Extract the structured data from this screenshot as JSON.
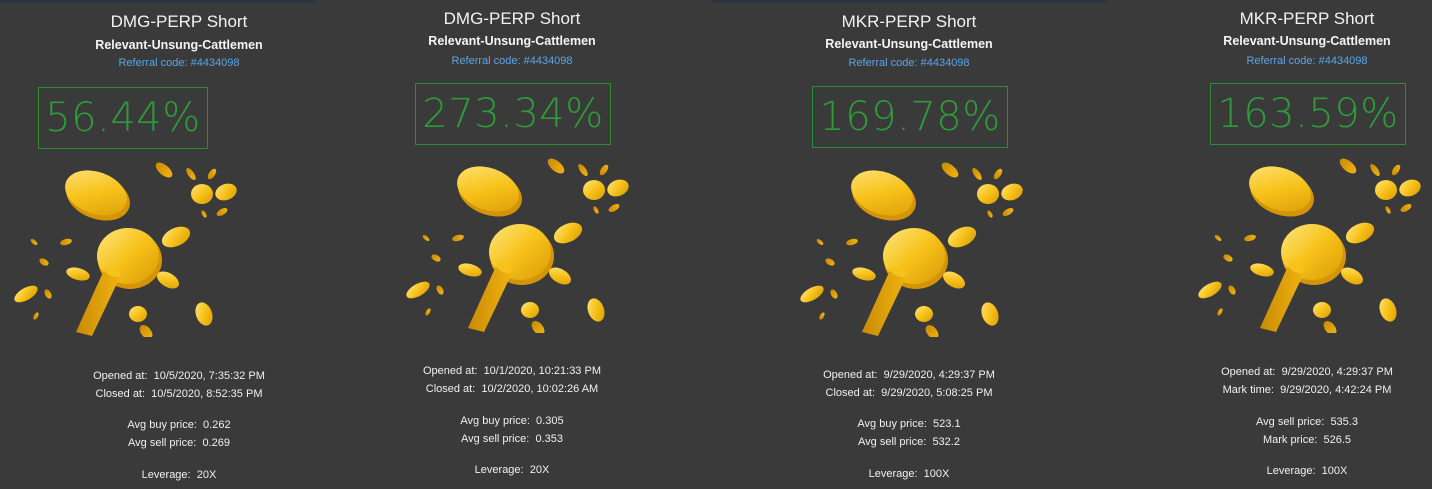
{
  "cards": [
    {
      "title": "DMG-PERP Short",
      "user": "Relevant-Unsung-Cattlemen",
      "referral": "Referral code: #4434098",
      "pct": "56.44%",
      "row1_label": "Opened at:",
      "row1_value": "10/5/2020, 7:35:32 PM",
      "row2_label": "Closed at:",
      "row2_value": "10/5/2020, 8:52:35 PM",
      "row3_label": "Avg buy price:",
      "row3_value": "0.262",
      "row4_label": "Avg sell price:",
      "row4_value": "0.269",
      "lev_label": "Leverage:",
      "lev_value": "20X"
    },
    {
      "title": "DMG-PERP Short",
      "user": "Relevant-Unsung-Cattlemen",
      "referral": "Referral code: #4434098",
      "pct": "273.34%",
      "row1_label": "Opened at:",
      "row1_value": "10/1/2020, 10:21:33 PM",
      "row2_label": "Closed at:",
      "row2_value": "10/2/2020, 10:02:26 AM",
      "row3_label": "Avg buy price:",
      "row3_value": "0.305",
      "row4_label": "Avg sell price:",
      "row4_value": "0.353",
      "lev_label": "Leverage:",
      "lev_value": "20X"
    },
    {
      "title": "MKR-PERP Short",
      "user": "Relevant-Unsung-Cattlemen",
      "referral": "Referral code: #4434098",
      "pct": "169.78%",
      "row1_label": "Opened at:",
      "row1_value": "9/29/2020, 4:29:37 PM",
      "row2_label": "Closed at:",
      "row2_value": "9/29/2020, 5:08:25 PM",
      "row3_label": "Avg buy price:",
      "row3_value": "523.1",
      "row4_label": "Avg sell price:",
      "row4_value": "532.2",
      "lev_label": "Leverage:",
      "lev_value": "100X"
    },
    {
      "title": "MKR-PERP Short",
      "user": "Relevant-Unsung-Cattlemen",
      "referral": "Referral code: #4434098",
      "pct": "163.59%",
      "row1_label": "Opened at:",
      "row1_value": "9/29/2020, 4:29:37 PM",
      "row2_label": "Mark time:",
      "row2_value": "9/29/2020, 4:42:24 PM",
      "row3_label": "Avg sell price:",
      "row3_value": "535.3",
      "row4_label": "Mark price:",
      "row4_value": "526.5",
      "lev_label": "Leverage:",
      "lev_value": "100X"
    }
  ],
  "colors": {
    "background": "#3a3a3a",
    "profit_green": "#2f9a3a",
    "referral_blue": "#5aa6e8",
    "coin_gold": "#f5c518"
  },
  "icons": {
    "illustration": "gold-coins-burst-icon"
  }
}
